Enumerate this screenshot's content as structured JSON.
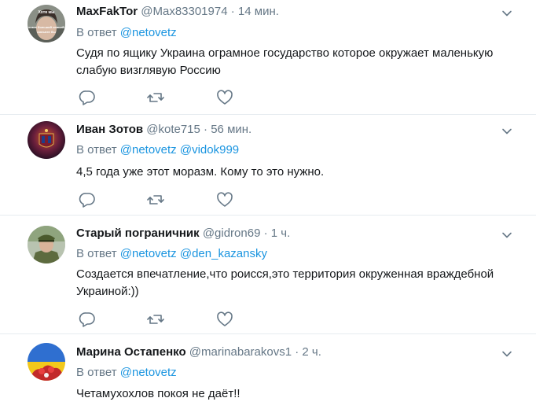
{
  "tweets": [
    {
      "name": "MaxFakTor",
      "handle": "@Max83301974",
      "sep": "·",
      "time": "14 мин.",
      "reply_prefix": "В ответ",
      "mentions": [
        "@netovetz"
      ],
      "text": "Судя по ящику Украина огрaмное государство которое окружает маленькую слабую визглявую Россию",
      "avatar_text": [
        "Хотя мы",
        "и все большой семьей",
        "сильнее бы"
      ],
      "has_actions": true
    },
    {
      "name": "Иван Зотов",
      "handle": "@kote715",
      "sep": "·",
      "time": "56 мин.",
      "reply_prefix": "В ответ",
      "mentions": [
        "@netovetz",
        "@vidok999"
      ],
      "text": "4,5 года уже этот моразм. Кому то это нужно.",
      "has_actions": true
    },
    {
      "name": "Старый пограничник",
      "handle": "@gidron69",
      "sep": "·",
      "time": "1 ч.",
      "reply_prefix": "В ответ",
      "mentions": [
        "@netovetz",
        "@den_kazansky"
      ],
      "text": "Создается впечатление,что роисся,это территория окруженная враждебной Украиной:))",
      "has_actions": true
    },
    {
      "name": "Марина Остапенко",
      "handle": "@marinabarakovs1",
      "sep": "·",
      "time": "2 ч.",
      "reply_prefix": "В ответ",
      "mentions": [
        "@netovetz"
      ],
      "text": "Четамухохлов покоя не даёт!!",
      "has_actions": false
    }
  ],
  "icons": {
    "reply": "reply-icon",
    "retweet": "retweet-icon",
    "like": "like-icon",
    "caret": "chevron-down-icon"
  },
  "colors": {
    "link": "#1b95e0",
    "muted": "#657786",
    "text": "#14171a",
    "divider": "#e6ecf0"
  }
}
